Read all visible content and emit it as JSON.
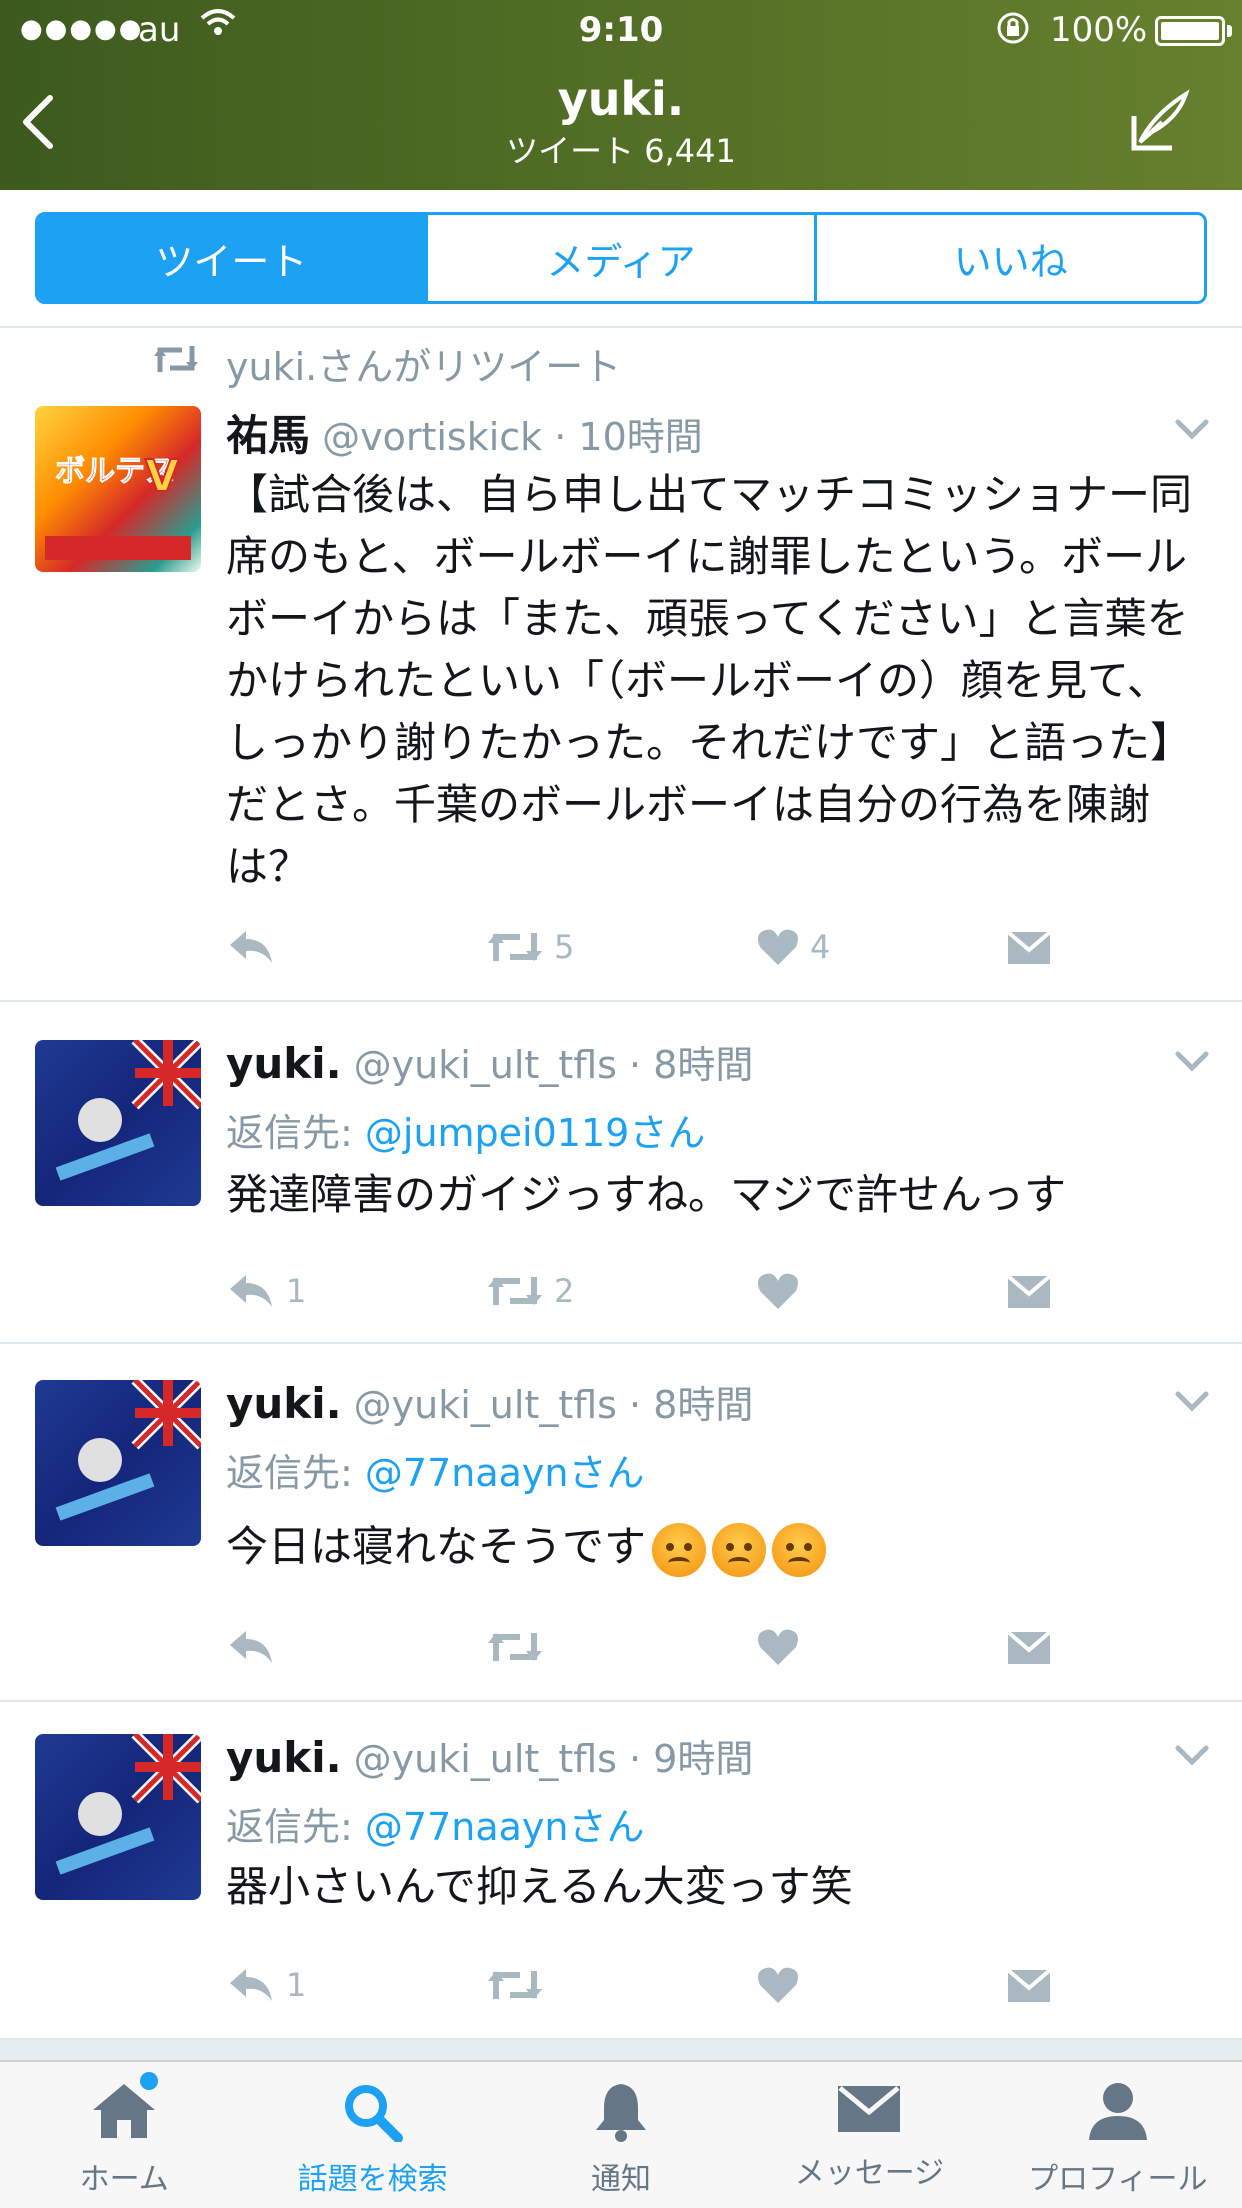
{
  "status_bar": {
    "signal": "●●●●●",
    "carrier": "au",
    "time": "9:10",
    "battery": "100%"
  },
  "nav": {
    "title": "yuki.",
    "subtitle": "ツイート 6,441"
  },
  "tabs": [
    {
      "label": "ツイート",
      "active": true
    },
    {
      "label": "メディア",
      "active": false
    },
    {
      "label": "いいね",
      "active": false
    }
  ],
  "tweets": [
    {
      "retweet_label": "yuki.さんがリツイート",
      "name": "祐馬",
      "meta": "@vortiskick · 10時間",
      "text": "【試合後は、自ら申し出てマッチコミッショナー同席のもと、ボールボーイに謝罪したという。ボールボーイからは「また、頑張ってください」と言葉をかけられたといい「（ボールボーイの）顔を見て、しっかり謝りたかった。それだけです」と語った】だとさ。千葉のボールボーイは自分の行為を陳謝は？",
      "reply_count": "",
      "retweet_count": "5",
      "like_count": "4"
    },
    {
      "name": "yuki.",
      "meta": "@yuki_ult_tfls · 8時間",
      "reply_prefix": "返信先: ",
      "reply_to": "@jumpei0119さん",
      "text": "発達障害のガイジっすね。マジで許せんっす",
      "reply_count": "1",
      "retweet_count": "2",
      "like_count": ""
    },
    {
      "name": "yuki.",
      "meta": "@yuki_ult_tfls · 8時間",
      "reply_prefix": "返信先: ",
      "reply_to": "@77naaynさん",
      "text": "今日は寝れなそうです",
      "emoji_count": 3,
      "reply_count": "",
      "retweet_count": "",
      "like_count": ""
    },
    {
      "name": "yuki.",
      "meta": "@yuki_ult_tfls · 9時間",
      "reply_prefix": "返信先: ",
      "reply_to": "@77naaynさん",
      "text": "器小さいんで抑えるん大変っす笑",
      "reply_count": "1",
      "retweet_count": "",
      "like_count": ""
    }
  ],
  "tabbar": [
    {
      "label": "ホーム",
      "icon": "home-icon",
      "active": false,
      "badge": true
    },
    {
      "label": "話題を検索",
      "icon": "search-icon",
      "active": true
    },
    {
      "label": "通知",
      "icon": "bell-icon",
      "active": false
    },
    {
      "label": "メッセージ",
      "icon": "envelope-icon",
      "active": false
    },
    {
      "label": "プロフィール",
      "icon": "person-icon",
      "active": false
    }
  ],
  "colors": {
    "accent": "#1da1f2",
    "header_green": "#4e6b24",
    "muted": "#8899a6",
    "icon_gray": "#aab8c2"
  }
}
